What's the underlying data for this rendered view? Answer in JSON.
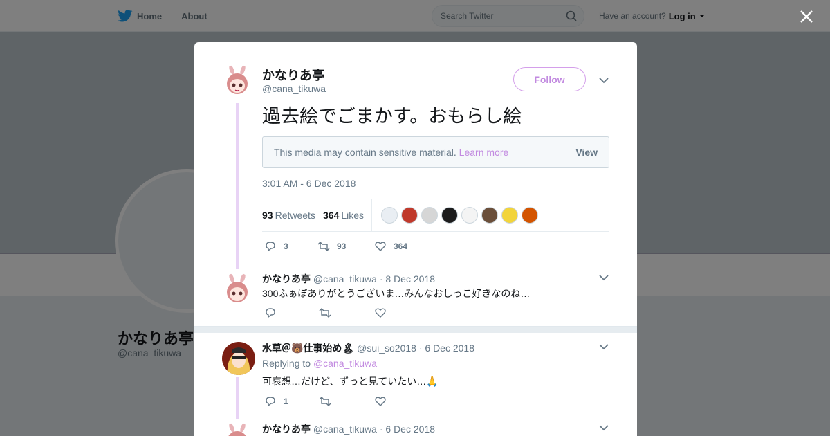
{
  "topbar": {
    "home_label": "Home",
    "about_label": "About",
    "search_placeholder": "Search Twitter",
    "account_prompt": "Have an account?",
    "login_label": "Log in"
  },
  "profile": {
    "name": "かなりあ亭",
    "handle": "@cana_tikuwa"
  },
  "main_tweet": {
    "author_name": "かなりあ亭",
    "author_handle": "@cana_tikuwa",
    "follow_label": "Follow",
    "text": "過去絵でごまかす。おもらし絵",
    "sensitive_message": "This media may contain sensitive material.",
    "learn_more": "Learn more",
    "view_label": "View",
    "timestamp": "3:01 AM - 6 Dec 2018",
    "retweets_count": "93",
    "retweets_label": "Retweets",
    "likes_count": "364",
    "likes_label": "Likes",
    "replies": "3",
    "retweets": "93",
    "likes": "364"
  },
  "replies": [
    {
      "author_name": "かなりあ亭",
      "author_handle": "@cana_tikuwa",
      "date": "8 Dec 2018",
      "text": "300ふぁぼありがとうございま…みんなおしっこ好きなのね…",
      "reply_count": "",
      "retweet_count": ""
    },
    {
      "author_name": "水草＠🐻仕事始め🏝",
      "author_handle": "@sui_so2018",
      "date": "6 Dec 2018",
      "replying_to_label": "Replying to",
      "replying_to": "@cana_tikuwa",
      "text": "可哀想…だけど、ずっと見ていたい…🙏",
      "reply_count": "1"
    },
    {
      "author_name": "かなりあ亭",
      "author_handle": "@cana_tikuwa",
      "date": "6 Dec 2018"
    }
  ],
  "colors": {
    "accent": "#c28ae0",
    "thread_line": "#e8d3f5",
    "twitter_blue": "#1da1f2"
  },
  "liker_colors": [
    "#e9eef3",
    "#c0392b",
    "#d6d6d6",
    "#1c1c1c",
    "#f4f4f4",
    "#6b4f3a",
    "#f2d43c",
    "#d35400"
  ]
}
